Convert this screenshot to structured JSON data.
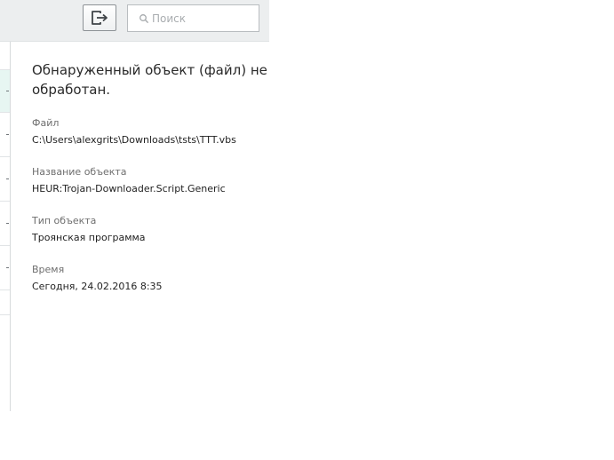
{
  "toolbar": {
    "export_icon": "export-icon",
    "search_icon": "search-icon",
    "search_placeholder": "Поиск",
    "search_value": ""
  },
  "details": {
    "title": "Обнаруженный объект (файл) не обработан.",
    "fields": [
      {
        "label": "Файл",
        "value": "C:\\Users\\alexgrits\\Downloads\\tsts\\TTT.vbs"
      },
      {
        "label": "Название объекта",
        "value": "HEUR:Trojan-Downloader.Script.Generic"
      },
      {
        "label": "Тип объекта",
        "value": "Троянская программа"
      },
      {
        "label": "Время",
        "value": "Сегодня, 24.02.2016 8:35"
      }
    ]
  },
  "colors": {
    "toolbar_background": "#eceeef",
    "selected_row": "#e7f6f2",
    "icon": "#3f4448"
  }
}
